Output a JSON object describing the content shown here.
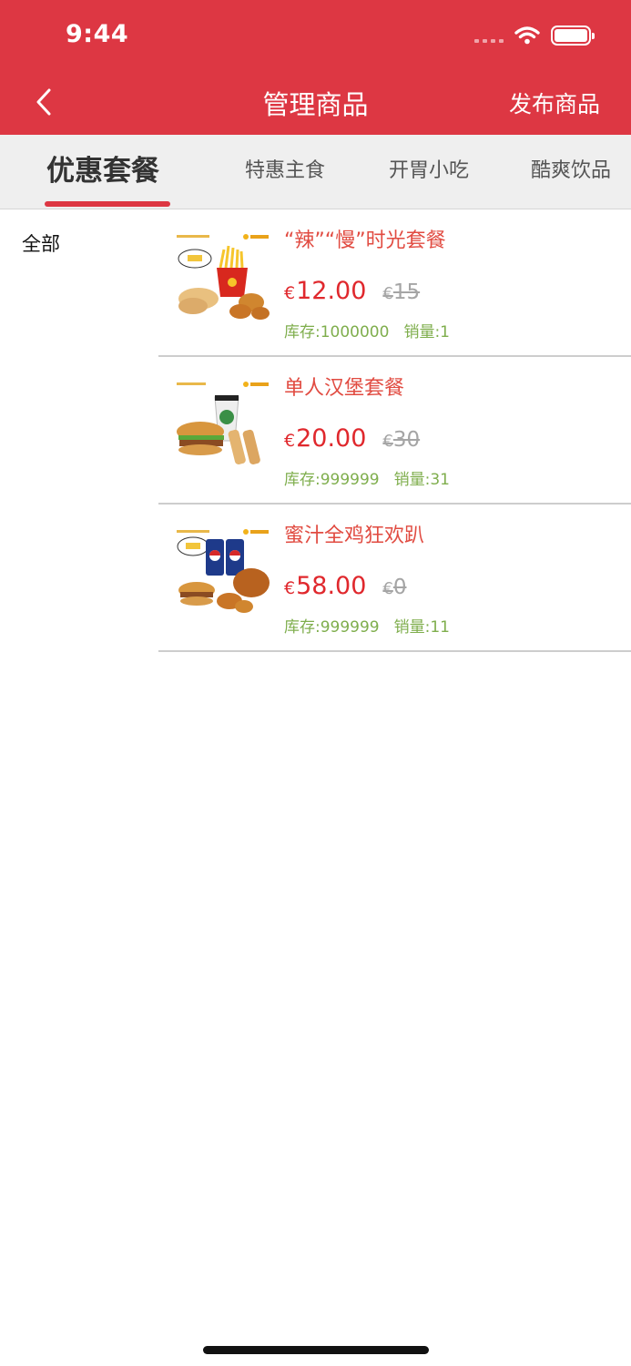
{
  "status_bar": {
    "time": "9:44"
  },
  "nav": {
    "title": "管理商品",
    "action_label": "发布商品"
  },
  "tabs": [
    {
      "label": "优惠套餐",
      "active": true
    },
    {
      "label": "特惠主食",
      "active": false
    },
    {
      "label": "开胃小吃",
      "active": false
    },
    {
      "label": "酷爽饮品",
      "active": false
    }
  ],
  "sidebar": {
    "items": [
      {
        "label": "全部"
      }
    ]
  },
  "currency": "€",
  "products": [
    {
      "name": "“辣”“慢”时光套餐",
      "price": "12.00",
      "old_price": "15",
      "stock": "库存:1000000",
      "sold": "销量:1"
    },
    {
      "name": "单人汉堡套餐",
      "price": "20.00",
      "old_price": "30",
      "stock": "库存:999999",
      "sold": "销量:31"
    },
    {
      "name": "蜜汁全鸡狂欢趴",
      "price": "58.00",
      "old_price": "0",
      "stock": "库存:999999",
      "sold": "销量:11"
    }
  ],
  "colors": {
    "brand": "#dd3743",
    "price": "#e0282d",
    "meta": "#7fae4d"
  },
  "icons": {
    "back": "chevron-left-icon",
    "wifi": "wifi-icon",
    "battery": "battery-icon"
  }
}
